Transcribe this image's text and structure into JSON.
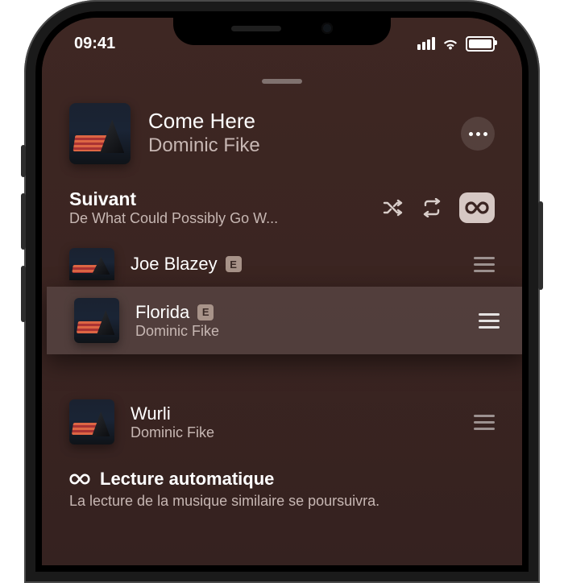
{
  "status": {
    "time": "09:41"
  },
  "now_playing": {
    "title": "Come Here",
    "artist": "Dominic Fike"
  },
  "up_next": {
    "heading": "Suivant",
    "source": "De What Could Possibly Go W...",
    "shuffle_on": false,
    "repeat_on": false,
    "autoplay_on": true
  },
  "queue": [
    {
      "title": "Joe Blazey",
      "artist": "",
      "explicit": true,
      "dragging": false,
      "partial": true
    },
    {
      "title": "Florida",
      "artist": "Dominic Fike",
      "explicit": true,
      "dragging": true,
      "partial": false
    },
    {
      "title": "Wurli",
      "artist": "Dominic Fike",
      "explicit": false,
      "dragging": false,
      "partial": false
    }
  ],
  "autoplay": {
    "heading": "Lecture automatique",
    "description": "La lecture de la musique similaire se poursuivra."
  },
  "badges": {
    "explicit": "E"
  }
}
